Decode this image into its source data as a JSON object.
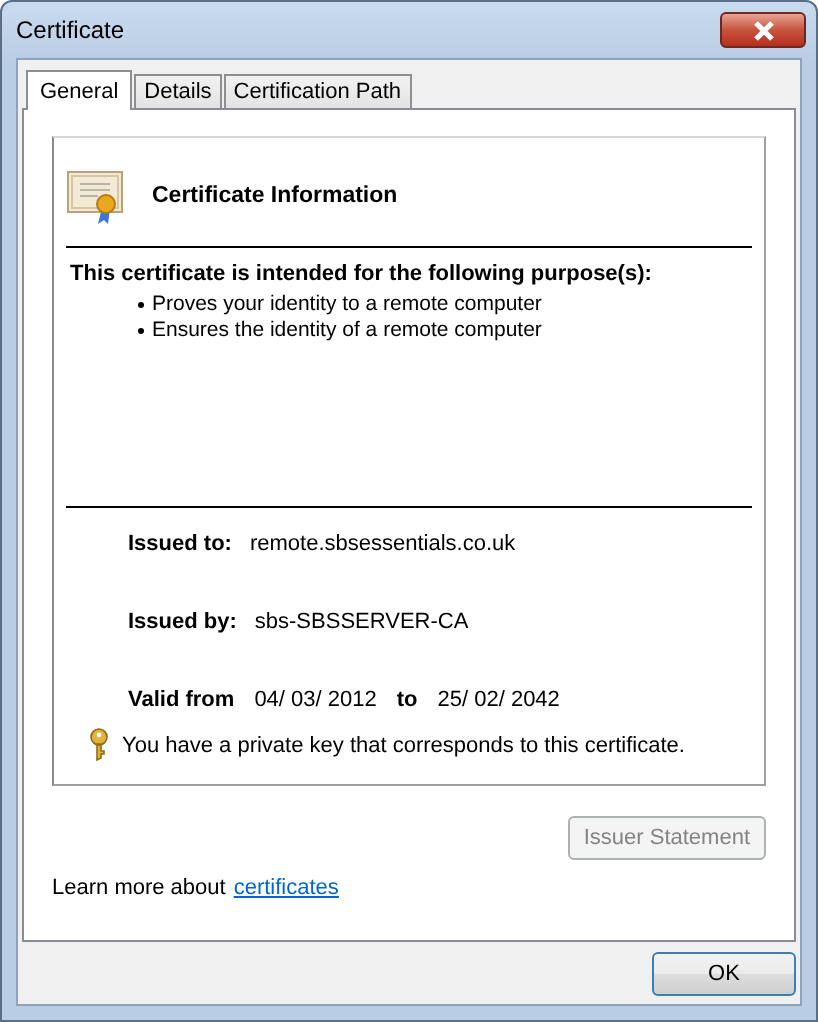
{
  "window": {
    "title": "Certificate"
  },
  "tabs": [
    {
      "label": "General",
      "selected": true
    },
    {
      "label": "Details",
      "selected": false
    },
    {
      "label": "Certification Path",
      "selected": false
    }
  ],
  "info": {
    "heading": "Certificate Information",
    "purpose_heading": "This certificate is intended for the following purpose(s):",
    "purposes": [
      "Proves your identity to a remote computer",
      "Ensures the identity of a remote computer"
    ],
    "issued_to": {
      "label": "Issued to:",
      "value": "remote.sbsessentials.co.uk"
    },
    "issued_by": {
      "label": "Issued by:",
      "value": "sbs-SBSSERVER-CA"
    },
    "valid": {
      "from_label": "Valid from",
      "from": "04/ 03/ 2012",
      "to_label": "to",
      "to": "25/ 02/ 2042"
    },
    "key_note": "You have a private key that corresponds to this certificate."
  },
  "issuer_statement_button": {
    "label": "Issuer Statement",
    "disabled": true
  },
  "learn_more": {
    "text": "Learn more about",
    "link": "certificates"
  },
  "buttons": [
    "OK"
  ]
}
